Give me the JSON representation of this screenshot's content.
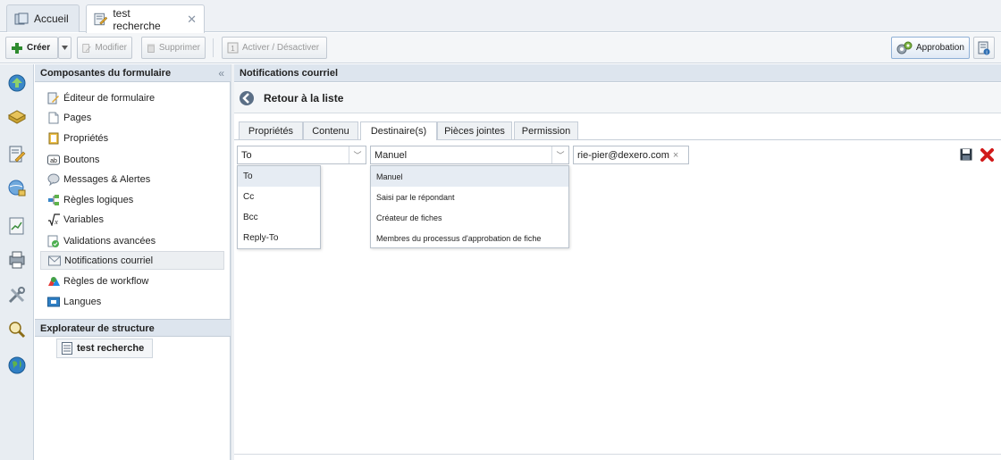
{
  "tabs": [
    {
      "label": "Accueil",
      "icon": "home-tab-icon"
    },
    {
      "label": "test recherche",
      "icon": "form-edit-icon",
      "close": "✕"
    }
  ],
  "toolbar": {
    "create": "Créer",
    "modify": "Modifier",
    "delete": "Supprimer",
    "toggle": "Activer / Désactiver",
    "approval": "Approbation"
  },
  "panel": {
    "title": "Composantes du formulaire",
    "collapse": "«",
    "items": [
      {
        "label": "Éditeur de formulaire",
        "icon": "form-editor-icon"
      },
      {
        "label": "Pages",
        "icon": "page-icon"
      },
      {
        "label": "Propriétés",
        "icon": "properties-icon"
      },
      {
        "label": "Boutons",
        "icon": "buttons-icon"
      },
      {
        "label": "Messages & Alertes",
        "icon": "message-icon"
      },
      {
        "label": "Règles logiques",
        "icon": "logic-rules-icon"
      },
      {
        "label": "Variables",
        "icon": "variables-icon"
      },
      {
        "label": "Validations avancées",
        "icon": "validation-icon"
      },
      {
        "label": "Notifications courriel",
        "icon": "email-icon"
      },
      {
        "label": "Règles de workflow",
        "icon": "workflow-icon"
      },
      {
        "label": "Langues",
        "icon": "languages-icon"
      }
    ],
    "explorer_title": "Explorateur de structure",
    "explorer_item": "test recherche"
  },
  "main": {
    "title": "Notifications courriel",
    "back": "Retour à la liste",
    "tabs": [
      "Propriétés",
      "Contenu",
      "Destinaire(s)",
      "Pièces jointes",
      "Permission"
    ],
    "active_tab": "Destinaire(s)",
    "type_value": "To",
    "source_value": "Manuel",
    "email_tag": "rie-pier@dexero.com",
    "email_tag_close": "×",
    "type_options": [
      "To",
      "Cc",
      "Bcc",
      "Reply-To"
    ],
    "source_options": [
      "Manuel",
      "Saisi par le répondant",
      "Créateur de fiches",
      "Membres du processus d'approbation de fiche"
    ]
  },
  "colors": {
    "accent": "#2f6fb3",
    "delete": "#d11a1a"
  }
}
